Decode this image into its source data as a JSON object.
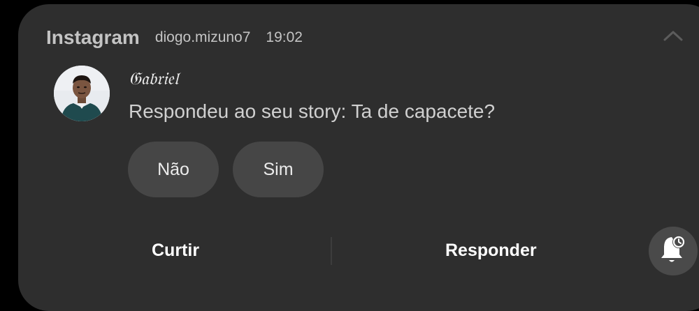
{
  "notification": {
    "app_name": "Instagram",
    "account": "diogo.mizuno7",
    "time": "19:02",
    "collapse_icon": "chevron-up-icon",
    "avatar_icon": "profile-photo",
    "sender": "𝔊𝔞𝔟𝔯𝔦𝔢𝔩",
    "message": "Respondeu ao seu story: Ta de capacete?"
  },
  "smart_replies": [
    {
      "label": "Não"
    },
    {
      "label": "Sim"
    }
  ],
  "actions": {
    "like": "Curtir",
    "reply": "Responder"
  },
  "snooze": {
    "icon": "bell-clock-icon"
  },
  "colors": {
    "background": "#000000",
    "card": "#2e2e2e",
    "chip": "#464646",
    "header_text": "#c4c4c4",
    "action_text": "#ffffff"
  }
}
